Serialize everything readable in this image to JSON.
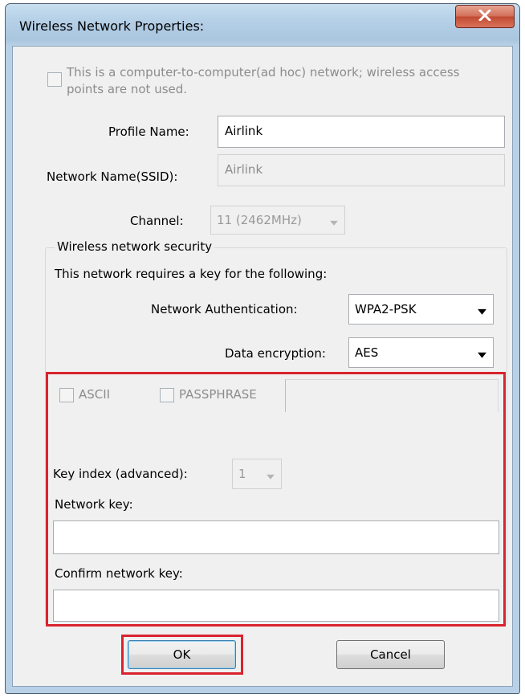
{
  "window": {
    "title": "Wireless Network Properties:"
  },
  "adhoc": {
    "checkbox_label": "This is a computer-to-computer(ad hoc) network; wireless access points are not used.",
    "checked": false
  },
  "profile": {
    "label": "Profile Name:",
    "value": "Airlink"
  },
  "ssid": {
    "label": "Network Name(SSID):",
    "value": "Airlink"
  },
  "channel": {
    "label": "Channel:",
    "value": "11 (2462MHz)"
  },
  "security": {
    "group_title": "Wireless network security",
    "requirement_text": "This network requires a key for the following:",
    "auth_label": "Network Authentication:",
    "auth_value": "WPA2-PSK",
    "encryption_label": "Data encryption:",
    "encryption_value": "AES",
    "ascii_label": "ASCII",
    "passphrase_label": "PASSPHRASE",
    "key_index_label": "Key index (advanced):",
    "key_index_value": "1",
    "network_key_label": "Network key:",
    "network_key_value": "",
    "confirm_key_label": "Confirm network key:",
    "confirm_key_value": ""
  },
  "buttons": {
    "ok": "OK",
    "cancel": "Cancel"
  },
  "colors": {
    "highlight": "#d9232e",
    "close_button": "#c24a33"
  },
  "icons": {
    "close": "close-icon",
    "dropdown": "chevron-down-icon"
  }
}
